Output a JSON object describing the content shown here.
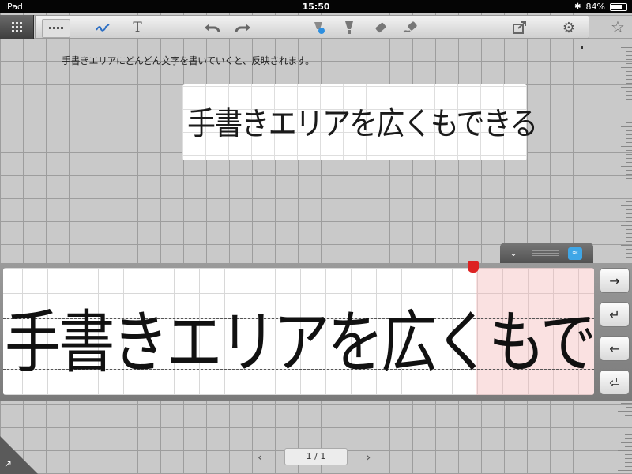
{
  "status_bar": {
    "device": "iPad",
    "time": "15:50",
    "battery": "84%",
    "battery_level": 0.84
  },
  "toolbar": {
    "grid_icon": "grid-icon",
    "items": [
      "menu-dots-icon",
      "pen-icon",
      "text-tool-icon",
      "undo-icon",
      "redo-icon",
      "pen-color-icon",
      "marker-icon",
      "eraser-icon",
      "stroke-eraser-icon",
      "export-icon",
      "gear-icon"
    ],
    "text_tool_label": "T"
  },
  "star": "star-icon",
  "note": {
    "instruction": "手書きエリアにどんどん文字を書いていくと、反映されます。",
    "preview_text": "手書きエリアを広くもできる"
  },
  "handwriting": {
    "text": "手書きエリアを広くもできる",
    "buttons": [
      "→",
      "↵",
      "←",
      "⏎"
    ]
  },
  "pager": {
    "page": "1 / 1"
  }
}
